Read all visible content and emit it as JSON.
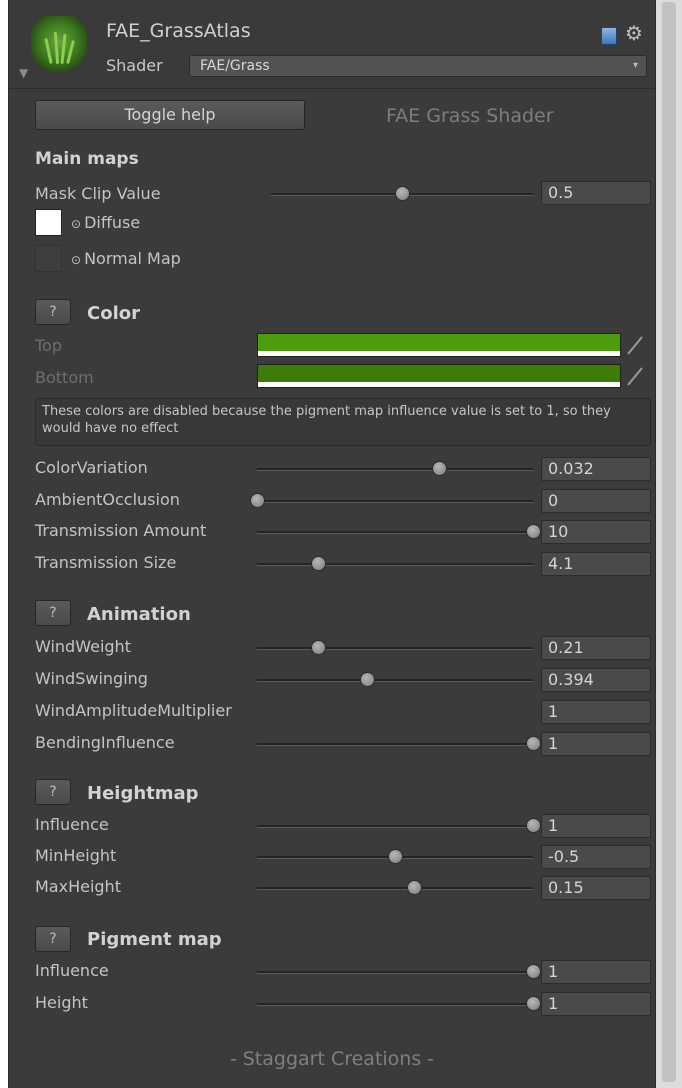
{
  "header": {
    "material_name": "FAE_GrassAtlas",
    "shader_label": "Shader",
    "shader_value": "FAE/Grass"
  },
  "toggle_help_label": "Toggle help",
  "shader_title": "FAE Grass Shader",
  "main_maps": {
    "title": "Main maps",
    "mask_clip_label": "Mask Clip Value",
    "mask_clip_value": "0.5",
    "mask_clip_fraction": 0.5,
    "diffuse_label": "Diffuse",
    "normal_label": "Normal Map"
  },
  "color_section": {
    "help_label": "?",
    "title": "Color",
    "top_label": "Top",
    "top_color": "#4c9c0c",
    "bottom_label": "Bottom",
    "bottom_color": "#3c7d0a",
    "info": "These colors are disabled because the pigment map influence value is set to 1, so they would have no effect",
    "sliders": [
      {
        "label": "ColorVariation",
        "value": "0.032",
        "fraction": 0.66
      },
      {
        "label": "AmbientOcclusion",
        "value": "0",
        "fraction": 0.0
      },
      {
        "label": "Transmission Amount",
        "value": "10",
        "fraction": 1.0
      },
      {
        "label": "Transmission Size",
        "value": "4.1",
        "fraction": 0.22
      }
    ]
  },
  "animation_section": {
    "help_label": "?",
    "title": "Animation",
    "sliders": [
      {
        "label": "WindWeight",
        "value": "0.21",
        "fraction": 0.22
      },
      {
        "label": "WindSwinging",
        "value": "0.394",
        "fraction": 0.4
      },
      {
        "label": "WindAmplitudeMultiplier",
        "value": "1"
      },
      {
        "label": "BendingInfluence",
        "value": "1",
        "fraction": 1.0
      }
    ]
  },
  "heightmap_section": {
    "help_label": "?",
    "title": "Heightmap",
    "sliders": [
      {
        "label": "Influence",
        "value": "1",
        "fraction": 1.0
      },
      {
        "label": "MinHeight",
        "value": "-0.5",
        "fraction": 0.5
      },
      {
        "label": "MaxHeight",
        "value": "0.15",
        "fraction": 0.57
      }
    ]
  },
  "pigment_section": {
    "help_label": "?",
    "title": "Pigment map",
    "sliders": [
      {
        "label": "Influence",
        "value": "1",
        "fraction": 1.0
      },
      {
        "label": "Height",
        "value": "1",
        "fraction": 1.0
      }
    ]
  },
  "footer": "- Staggart Creations -"
}
